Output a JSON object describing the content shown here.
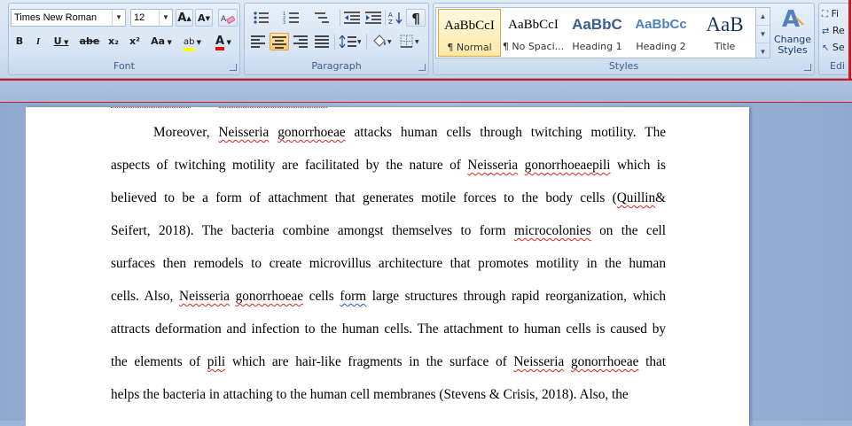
{
  "ribbon": {
    "font_group": {
      "label": "Font",
      "font_family": "Times New Roman",
      "font_size": "12",
      "grow_label": "A",
      "shrink_label": "A",
      "bold": "B",
      "italic": "I",
      "underline": "U",
      "strike": "abe",
      "subscript": "x₂",
      "superscript": "x²",
      "change_case": "Aa",
      "highlight": "ab",
      "font_color": "A"
    },
    "paragraph_group": {
      "label": "Paragraph"
    },
    "styles_group": {
      "label": "Styles",
      "items": [
        {
          "sample": "AaBbCcI",
          "name": "¶ Normal"
        },
        {
          "sample": "AaBbCcI",
          "name": "¶ No Spaci..."
        },
        {
          "sample": "AaBbC",
          "name": "Heading 1"
        },
        {
          "sample": "AaBbCc",
          "name": "Heading 2"
        },
        {
          "sample": "AaB",
          "name": "Title"
        }
      ],
      "change_styles": "Change Styles"
    },
    "editing_group": {
      "label": "Edi",
      "find": "Fi",
      "replace": "Re",
      "select": "Se"
    }
  },
  "document": {
    "lines": [
      {
        "segments": [
          {
            "t": "Moreover, "
          },
          {
            "t": "Neisseria",
            "sq": "red"
          },
          {
            "t": " "
          },
          {
            "t": "gonorrhoeae",
            "sq": "red"
          },
          {
            "t": " attacks human cells through twitching motility. The"
          }
        ]
      },
      {
        "segments": [
          {
            "t": "aspects of twitching motility are facilitated by the nature of "
          },
          {
            "t": "Neisseria",
            "sq": "red"
          },
          {
            "t": " "
          },
          {
            "t": "gonorrhoeaepili",
            "sq": "red"
          },
          {
            "t": " which is"
          }
        ]
      },
      {
        "segments": [
          {
            "t": "believed to be a form of attachment that generates motile forces to the body cells ("
          },
          {
            "t": "Quillin",
            "sq": "red"
          },
          {
            "t": "&"
          }
        ]
      },
      {
        "segments": [
          {
            "t": "Seifert, 2018). The bacteria combine amongst themselves to form "
          },
          {
            "t": "microcolonies",
            "sq": "red"
          },
          {
            "t": " on the cell"
          }
        ]
      },
      {
        "segments": [
          {
            "t": "surfaces then remodels to create microvillus  architecture that promotes motility in the human"
          }
        ]
      },
      {
        "segments": [
          {
            "t": "cells. Also, "
          },
          {
            "t": "Neisseria",
            "sq": "red"
          },
          {
            "t": " "
          },
          {
            "t": "gonorrhoeae",
            "sq": "red"
          },
          {
            "t": " cells "
          },
          {
            "t": "form",
            "sq": "blue"
          },
          {
            "t": " large structures through rapid reorganization, which"
          }
        ]
      },
      {
        "segments": [
          {
            "t": "attracts deformation and infection to the human cells. The attachment to human cells is caused by"
          }
        ]
      },
      {
        "segments": [
          {
            "t": "the elements of "
          },
          {
            "t": "pili",
            "sq": "red"
          },
          {
            "t": " which are hair-like fragments in the surface of "
          },
          {
            "t": "Neisseria",
            "sq": "red"
          },
          {
            "t": " "
          },
          {
            "t": "gonorrhoeae",
            "sq": "red"
          },
          {
            "t": " that"
          }
        ]
      },
      {
        "segments": [
          {
            "t": "helps the bacteria in attaching to the human cell membranes  (Stevens & Crisis, 2018). Also, the"
          }
        ]
      }
    ]
  },
  "colors": {
    "ribbon_bg": "#d6e4f4",
    "highlight_yellow": "#ffff00",
    "font_color_red": "#ff0000",
    "spell_error": "#e0251d",
    "grammar_error": "#2b4fd6"
  }
}
